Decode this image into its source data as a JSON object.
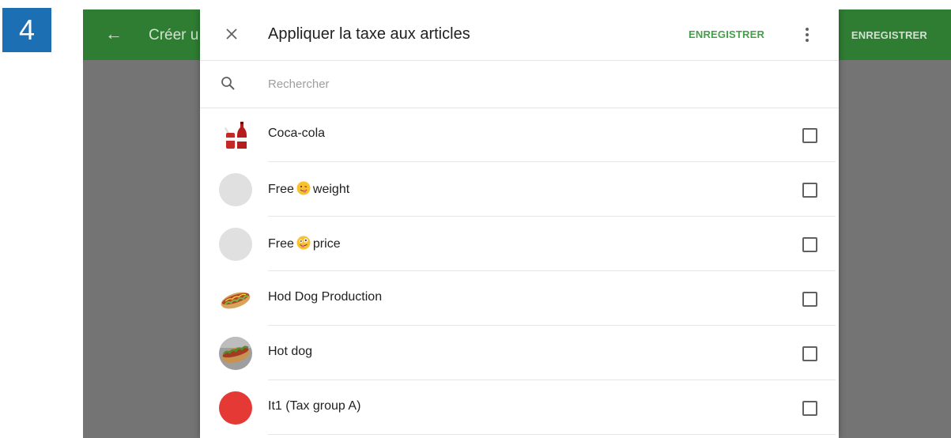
{
  "step_number": "4",
  "appbar": {
    "back_icon": "arrow-left-icon",
    "title": "Créer u",
    "save_label": "ENREGISTRER"
  },
  "dialog": {
    "title": "Appliquer la taxe aux articles",
    "save_label": "ENREGISTRER",
    "close_icon": "close-icon",
    "more_icon": "more-vert-icon",
    "search": {
      "placeholder": "Rechercher",
      "value": "",
      "icon": "search-icon"
    },
    "items": [
      {
        "name": "Coca-cola",
        "thumb": "coca-cola-image",
        "checked": false
      },
      {
        "name_before": "Free",
        "emoji": "winking-face-tongue-icon",
        "name_after": "weight",
        "thumb": "grey-circle",
        "checked": false
      },
      {
        "name_before": "Free",
        "emoji": "zany-face-icon",
        "name_after": "price",
        "thumb": "grey-circle",
        "checked": false
      },
      {
        "name": "Hod Dog Production",
        "thumb": "hot-dog-image",
        "checked": false
      },
      {
        "name": "Hot dog",
        "thumb": "hot-dog-image",
        "checked": false
      },
      {
        "name": "It1 (Tax group A)",
        "thumb": "red-circle",
        "thumb_color": "#e53935",
        "checked": false
      }
    ]
  },
  "colors": {
    "appbar": "#2e7d32",
    "accent": "#43a047",
    "badge": "#1d6fb3",
    "overlay": "#747474"
  }
}
